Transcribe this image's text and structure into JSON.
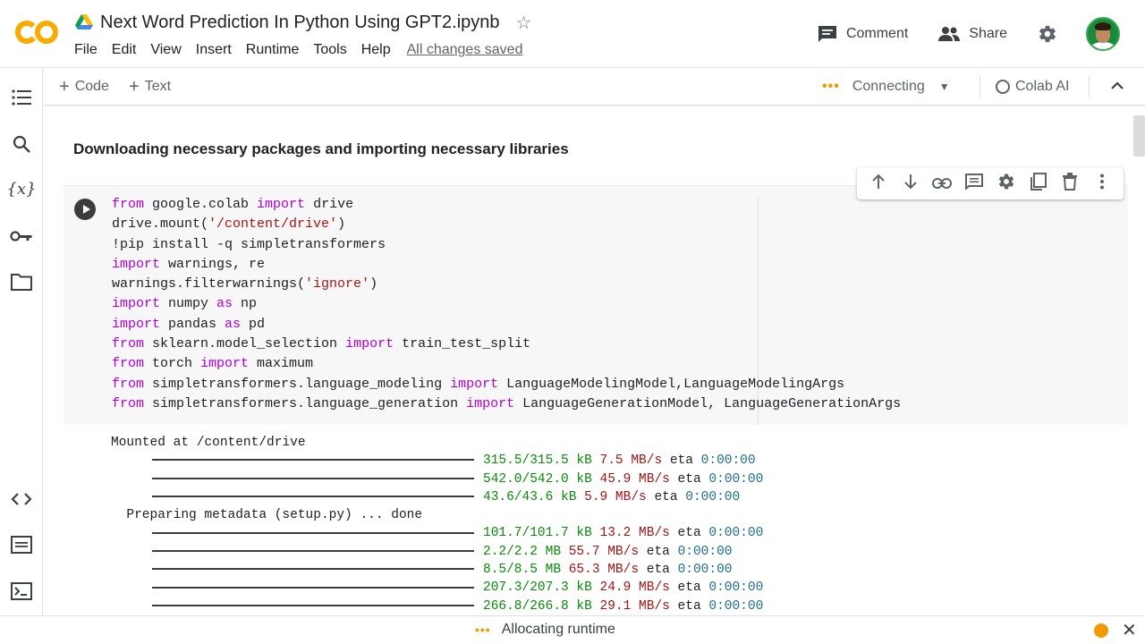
{
  "header": {
    "title": "Next Word Prediction In Python Using GPT2.ipynb",
    "menu": [
      "File",
      "Edit",
      "View",
      "Insert",
      "Runtime",
      "Tools",
      "Help"
    ],
    "saved_status": "All changes saved",
    "comment_label": "Comment",
    "share_label": "Share"
  },
  "toolbar": {
    "add_code": "Code",
    "add_text": "Text",
    "connection_status": "Connecting",
    "colab_ai_label": "Colab AI"
  },
  "notebook": {
    "heading": "Downloading necessary packages and importing necessary libraries"
  },
  "code_lines": [
    [
      {
        "t": "from",
        "c": "kw"
      },
      {
        "t": " google.colab "
      },
      {
        "t": "import",
        "c": "kw"
      },
      {
        "t": " drive"
      }
    ],
    [
      {
        "t": "drive.mount("
      },
      {
        "t": "'/content/drive'",
        "c": "str"
      },
      {
        "t": ")"
      }
    ],
    [
      {
        "t": "!pip install -q simpletransformers"
      }
    ],
    [
      {
        "t": "import",
        "c": "kw"
      },
      {
        "t": " warnings, re"
      }
    ],
    [
      {
        "t": "warnings.filterwarnings("
      },
      {
        "t": "'ignore'",
        "c": "str"
      },
      {
        "t": ")"
      }
    ],
    [
      {
        "t": "import",
        "c": "kw"
      },
      {
        "t": " numpy "
      },
      {
        "t": "as",
        "c": "kw"
      },
      {
        "t": " np"
      }
    ],
    [
      {
        "t": "import",
        "c": "kw"
      },
      {
        "t": " pandas "
      },
      {
        "t": "as",
        "c": "kw"
      },
      {
        "t": " pd"
      }
    ],
    [
      {
        "t": "from",
        "c": "kw"
      },
      {
        "t": " sklearn.model_selection "
      },
      {
        "t": "import",
        "c": "kw"
      },
      {
        "t": " train_test_split"
      }
    ],
    [
      {
        "t": "from",
        "c": "kw"
      },
      {
        "t": " torch "
      },
      {
        "t": "import",
        "c": "kw"
      },
      {
        "t": " maximum"
      }
    ],
    [
      {
        "t": "from",
        "c": "kw"
      },
      {
        "t": " simpletransformers.language_modeling "
      },
      {
        "t": "import",
        "c": "kw"
      },
      {
        "t": " LanguageModelingModel,LanguageModelingArgs"
      }
    ],
    [
      {
        "t": "from",
        "c": "kw"
      },
      {
        "t": " simpletransformers.language_generation "
      },
      {
        "t": "import",
        "c": "kw"
      },
      {
        "t": " LanguageGenerationModel, LanguageGenerationArgs"
      }
    ]
  ],
  "output": {
    "mounted": "Mounted at /content/drive",
    "metadata": "  Preparing metadata (setup.py) ... done",
    "downloads": [
      {
        "size": "315.5/315.5 kB",
        "speed": "7.5 MB/s",
        "eta": "0:00:00"
      },
      {
        "size": "542.0/542.0 kB",
        "speed": "45.9 MB/s",
        "eta": "0:00:00"
      },
      {
        "size": "43.6/43.6 kB",
        "speed": "5.9 MB/s",
        "eta": "0:00:00"
      },
      null,
      {
        "size": "101.7/101.7 kB",
        "speed": "13.2 MB/s",
        "eta": "0:00:00"
      },
      {
        "size": "2.2/2.2 MB",
        "speed": "55.7 MB/s",
        "eta": "0:00:00"
      },
      {
        "size": "8.5/8.5 MB",
        "speed": "65.3 MB/s",
        "eta": "0:00:00"
      },
      {
        "size": "207.3/207.3 kB",
        "speed": "24.9 MB/s",
        "eta": "0:00:00"
      },
      {
        "size": "266.8/266.8 kB",
        "speed": "29.1 MB/s",
        "eta": "0:00:00"
      }
    ]
  },
  "status": {
    "allocating": "Allocating runtime"
  },
  "colors": {
    "accent": "#f29900",
    "keyword": "#af00db",
    "string": "#a31515",
    "size_green": "#0a8a0a"
  }
}
